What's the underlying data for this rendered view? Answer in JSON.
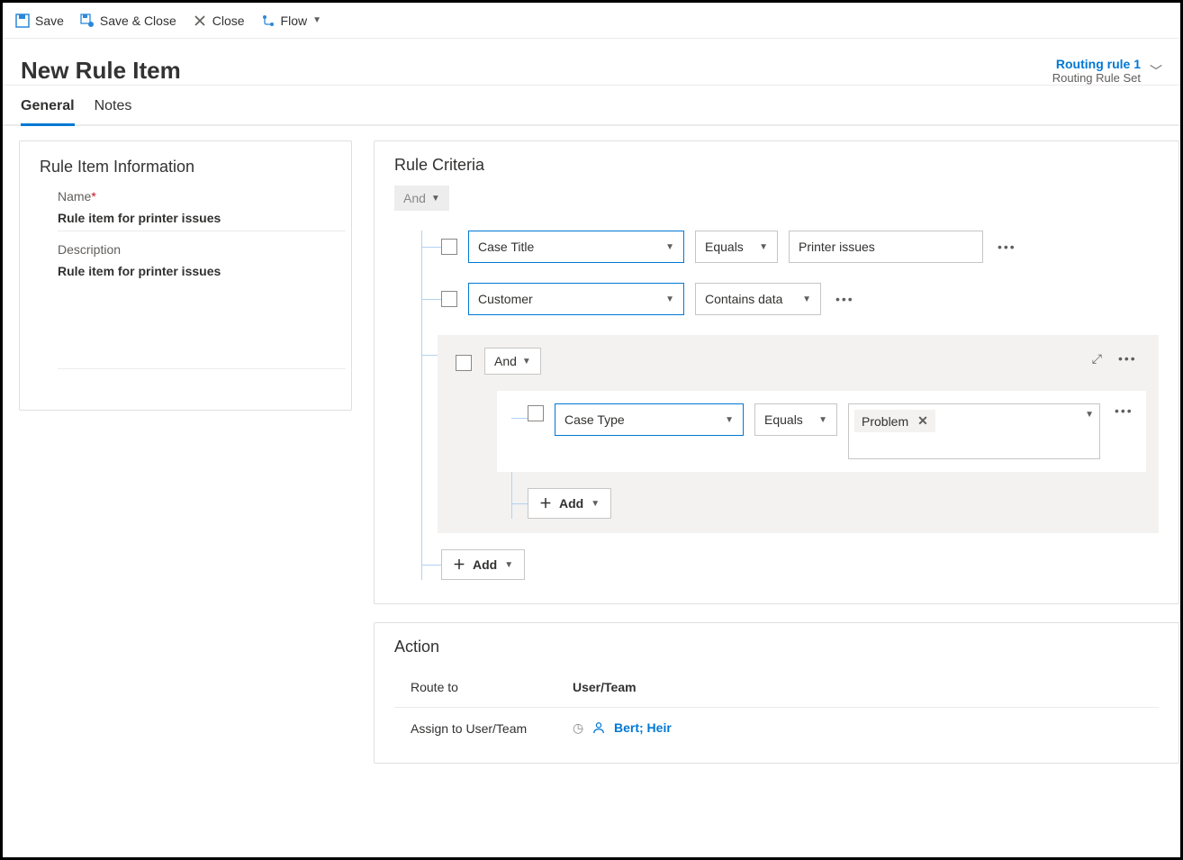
{
  "commands": {
    "save": "Save",
    "save_close": "Save & Close",
    "close": "Close",
    "flow": "Flow"
  },
  "header": {
    "title": "New Rule Item",
    "routing_rule_name": "Routing rule 1",
    "routing_rule_sub": "Routing Rule Set"
  },
  "tabs": {
    "general": "General",
    "notes": "Notes"
  },
  "info": {
    "section_title": "Rule Item Information",
    "name_label": "Name",
    "name_value": "Rule item for printer issues",
    "desc_label": "Description",
    "desc_value": "Rule item for printer issues"
  },
  "criteria": {
    "section_title": "Rule Criteria",
    "top_op": "And",
    "rows": [
      {
        "field": "Case Title",
        "op": "Equals",
        "value": "Printer issues"
      },
      {
        "field": "Customer",
        "op": "Contains data",
        "value": ""
      }
    ],
    "group_op": "And",
    "group_row": {
      "field": "Case Type",
      "op": "Equals",
      "tag": "Problem"
    },
    "add_label": "Add"
  },
  "action": {
    "section_title": "Action",
    "route_to_label": "Route to",
    "route_to_value": "User/Team",
    "assign_label": "Assign to User/Team",
    "assign_value": "Bert; Heir"
  }
}
